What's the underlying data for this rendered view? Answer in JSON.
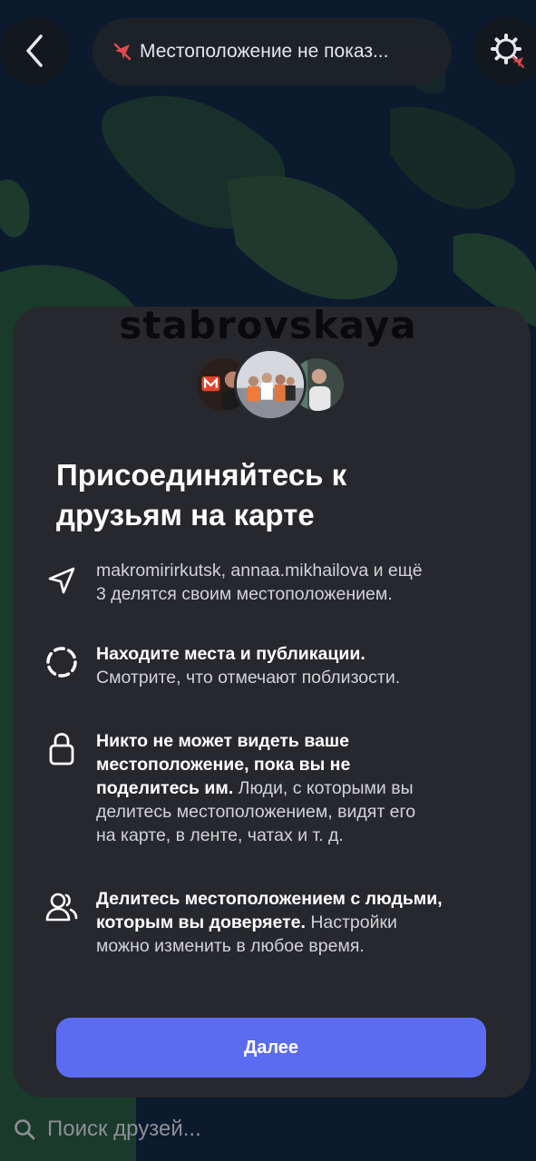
{
  "header": {
    "location_status": "Местоположение не показ...",
    "back_icon": "chevron-left-icon",
    "settings_icon": "gear-location-off-icon"
  },
  "sheet": {
    "watermark": "stabrovskaya",
    "heading_line1": "Присоединяйтесь к",
    "heading_line2": "друзьям на карте",
    "features": [
      {
        "icon": "navigation-arrow-icon",
        "bold": "",
        "text_lines": [
          "makromirirkutsk, annaa.mikhailova и ещё",
          "3 делятся своим местоположением."
        ]
      },
      {
        "icon": "dashed-circle-icon",
        "bold": "Находите места и публикации.",
        "text": "Смотрите, что отмечают поблизости."
      },
      {
        "icon": "lock-icon",
        "bold_lines": [
          "Никто не может видеть ваше",
          "местоположение, пока вы не",
          "поделитесь им."
        ],
        "text_after_bold": " Люди, с которыми вы",
        "text_lines": [
          "делитесь местоположением, видят его",
          "на карте, в ленте, чатах и т. д."
        ]
      },
      {
        "icon": "people-icon",
        "bold_lines": [
          "Делитесь местоположением с людьми,",
          "которым вы доверяете."
        ],
        "text_after_bold": " Настройки",
        "text_lines": [
          "можно изменить в любое время."
        ]
      }
    ],
    "next_button": "Далее"
  },
  "search": {
    "placeholder": "Поиск друзей...",
    "icon": "search-icon"
  },
  "colors": {
    "accent": "#5b6cf2",
    "sheet_bg": "#27282d",
    "map_water": "#0c1a2e",
    "location_off_red": "#e5484d"
  }
}
